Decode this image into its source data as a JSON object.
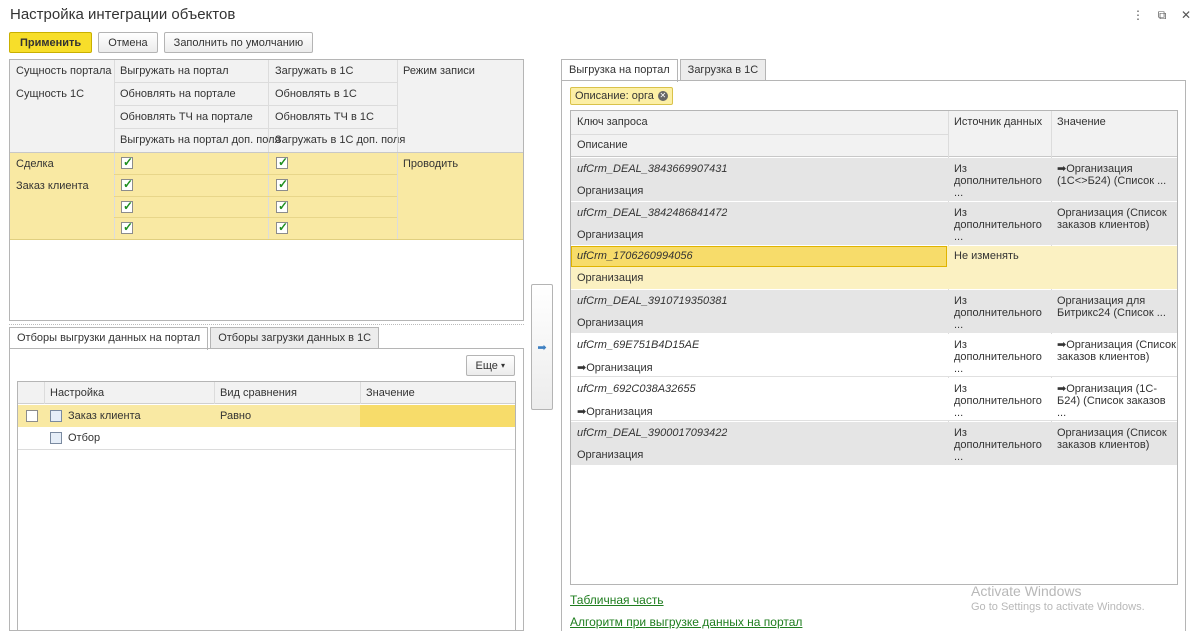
{
  "window": {
    "title": "Настройка интеграции объектов",
    "controls": [
      "⋮",
      "⧉",
      "✕"
    ]
  },
  "toolbar": {
    "apply": "Применить",
    "cancel": "Отмена",
    "fill_default": "Заполнить по умолчанию"
  },
  "entity_table": {
    "headers": {
      "portal_entity": "Сущность портала",
      "entity_1c": "Сущность 1С",
      "upload_portal": "Выгружать на портал",
      "update_portal": "Обновлять на портале",
      "update_tc_portal": "Обновлять ТЧ на портале",
      "upload_portal_extra": "Выгружать на портал доп. поля",
      "load_1c": "Загружать в 1С",
      "update_1c": "Обновлять в 1С",
      "update_tc_1c": "Обновлять ТЧ в 1С",
      "load_1c_extra": "Загружать в 1С доп. поля",
      "write_mode": "Режим записи"
    },
    "row": {
      "portal_entity": "Сделка",
      "entity_1c": "Заказ клиента",
      "write_mode": "Проводить",
      "checks": [
        true,
        true,
        true,
        true,
        true,
        true,
        true,
        true
      ]
    }
  },
  "left_tabs": [
    "Отборы выгрузки данных на портал",
    "Отборы загрузки данных в 1С"
  ],
  "filters": {
    "more_button": "Еще",
    "columns": [
      "Настройка",
      "Вид сравнения",
      "Значение"
    ],
    "rows": [
      {
        "setting": "Заказ клиента",
        "comparison": "Равно",
        "value": "",
        "checked": false
      },
      {
        "setting": "Отбор",
        "comparison": "",
        "value": ""
      }
    ]
  },
  "right_tabs": [
    "Выгрузка на портал",
    "Загрузка в 1С"
  ],
  "filter_chip": "Описание: орга",
  "mapping": {
    "columns": {
      "key": "Ключ запроса",
      "description": "Описание",
      "source": "Источник данных",
      "value": "Значение"
    },
    "rows": [
      {
        "key": "ufCrm_DEAL_3843669907431",
        "desc": "Организация",
        "source": "Из дополнительного ...",
        "value": "➡Организация (1С<>Б24) (Список ..."
      },
      {
        "key": "ufCrm_DEAL_3842486841472",
        "desc": "Организация",
        "source": "Из дополнительного ...",
        "value": "Организация  (Список заказов клиентов)"
      },
      {
        "key": "ufCrm_1706260994056",
        "desc": "Организация",
        "source": "Не изменять",
        "value": ""
      },
      {
        "key": "ufCrm_DEAL_3910719350381",
        "desc": "Организация",
        "source": "Из дополнительного ...",
        "value": "Организация для Битрикс24 (Список ..."
      },
      {
        "key": "ufCrm_69E751B4D15AE",
        "desc": "➡Организация",
        "source": "Из дополнительного ...",
        "value": "➡Организация (Список заказов клиентов)"
      },
      {
        "key": "ufCrm_692C038A32655",
        "desc": "➡Организация",
        "source": "Из дополнительного ...",
        "value": "➡Организация (1С-Б24) (Список заказов ..."
      },
      {
        "key": "ufCrm_DEAL_3900017093422",
        "desc": "Организация",
        "source": "Из дополнительного ...",
        "value": "Организация  (Список заказов клиентов)"
      }
    ]
  },
  "links": {
    "tabular": "Табличная часть",
    "algorithm": "Алгоритм при выгрузке данных на портал"
  },
  "watermark": {
    "line1": "Activate Windows",
    "line2": "Go to Settings to activate Windows."
  },
  "colors": {
    "accent_yellow": "#f7de2a",
    "selected_row": "#f9e9a3",
    "check_green": "#1f8f1f",
    "link_green": "#1e7d1e"
  }
}
